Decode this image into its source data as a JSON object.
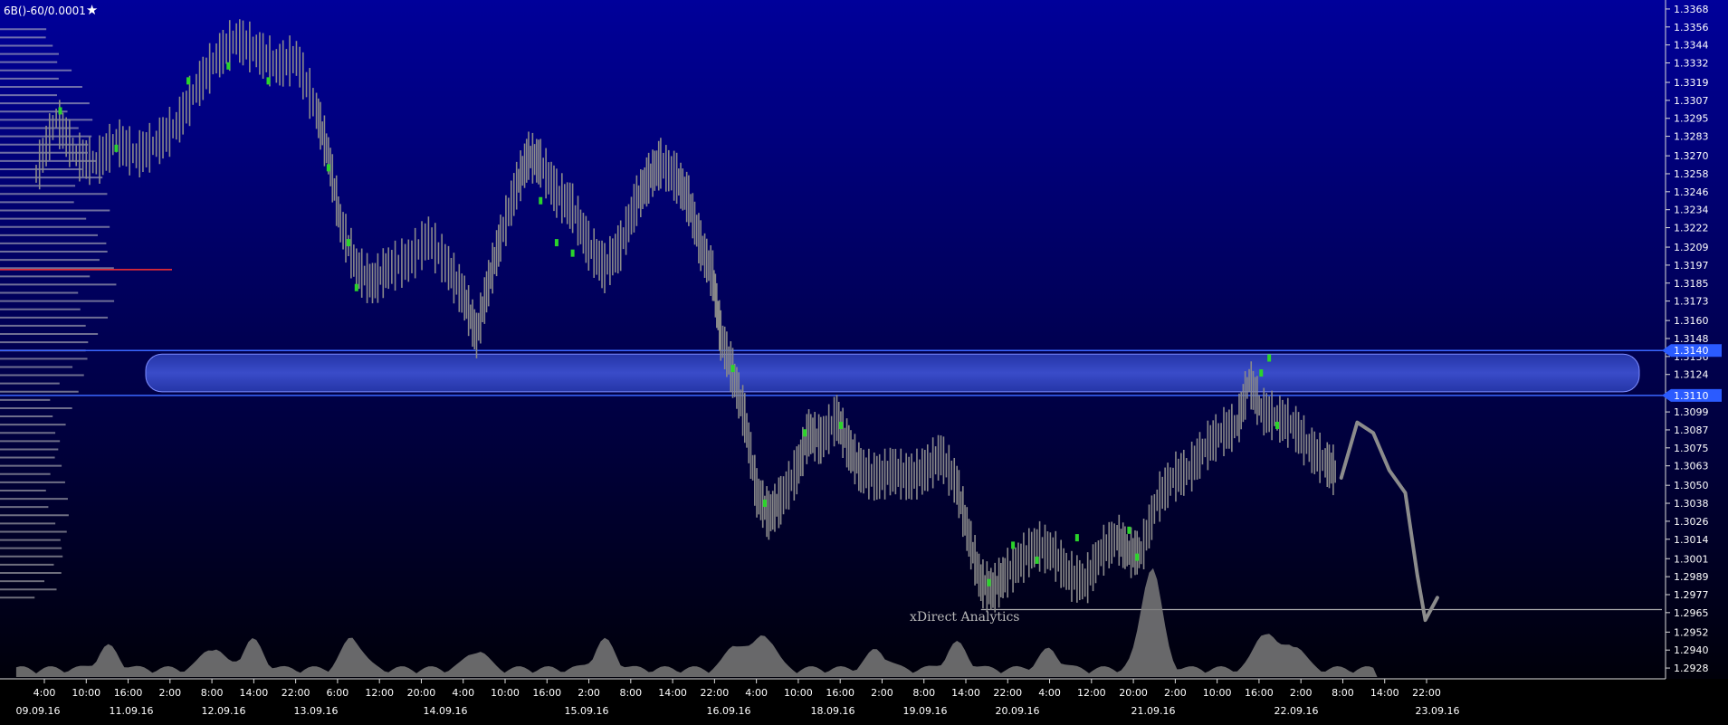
{
  "symbol": "6B()-60/0.0001",
  "watermark": "xDirect Analytics",
  "colors": {
    "background_top": "#00009a",
    "background_bottom": "#000000",
    "bar": "#8a8a8a",
    "highlight": "#2bd42b",
    "zone_fill": "#2c3fb8",
    "zone_line": "#3a66ff",
    "tag": "#2b5bff",
    "profile": "#c8c8c8",
    "poc": "#ff3030",
    "volume": "#7a7a7a",
    "arrow": "#8c8c8c"
  },
  "chart_data": {
    "type": "candlestick",
    "timeframe": "60",
    "ylim": [
      1.2922,
      1.3374
    ],
    "y_ticks": [
      "1.3368",
      "1.3356",
      "1.3344",
      "1.3332",
      "1.3319",
      "1.3307",
      "1.3295",
      "1.3283",
      "1.3270",
      "1.3258",
      "1.3246",
      "1.3234",
      "1.3222",
      "1.3209",
      "1.3197",
      "1.3185",
      "1.3173",
      "1.3160",
      "1.3148",
      "1.3136",
      "1.3124",
      "1.3099",
      "1.3087",
      "1.3075",
      "1.3063",
      "1.3050",
      "1.3038",
      "1.3026",
      "1.3014",
      "1.3001",
      "1.2989",
      "1.2977",
      "1.2965",
      "1.2952",
      "1.2940",
      "1.2928"
    ],
    "time_ticks": [
      "4:00",
      "10:00",
      "16:00",
      "2:00",
      "8:00",
      "14:00",
      "22:00",
      "6:00",
      "12:00",
      "20:00",
      "4:00",
      "10:00",
      "16:00",
      "2:00",
      "8:00",
      "14:00",
      "22:00",
      "4:00",
      "10:00",
      "16:00",
      "2:00",
      "8:00",
      "14:00",
      "22:00",
      "4:00",
      "12:00",
      "20:00",
      "2:00",
      "10:00",
      "16:00",
      "2:00",
      "8:00",
      "14:00",
      "22:00"
    ],
    "date_ticks": [
      "09.09.16",
      "11.09.16",
      "12.09.16",
      "13.09.16",
      "14.09.16",
      "15.09.16",
      "16.09.16",
      "18.09.16",
      "19.09.16",
      "20.09.16",
      "21.09.16",
      "22.09.16",
      "23.09.16"
    ],
    "zone": {
      "upper": 1.314,
      "lower": 1.311,
      "upper_label": "1.3140",
      "lower_label": "1.3110"
    },
    "support_level": 1.2967,
    "poc_level": 1.3194,
    "price_path": [
      [
        0,
        1.3258
      ],
      [
        0.5,
        1.3295
      ],
      [
        1,
        1.327
      ],
      [
        1.5,
        1.3265
      ],
      [
        2,
        1.328
      ],
      [
        2.5,
        1.327
      ],
      [
        3,
        1.3278
      ],
      [
        3.5,
        1.329
      ],
      [
        4,
        1.3315
      ],
      [
        4.5,
        1.3335
      ],
      [
        5,
        1.3348
      ],
      [
        5.5,
        1.334
      ],
      [
        6,
        1.333
      ],
      [
        6.5,
        1.3335
      ],
      [
        7,
        1.33
      ],
      [
        7.3,
        1.327
      ],
      [
        7.6,
        1.3225
      ],
      [
        8,
        1.3195
      ],
      [
        8.4,
        1.3185
      ],
      [
        8.8,
        1.3195
      ],
      [
        9.3,
        1.32
      ],
      [
        9.8,
        1.3215
      ],
      [
        10.3,
        1.3195
      ],
      [
        10.7,
        1.3175
      ],
      [
        11,
        1.315
      ],
      [
        11.3,
        1.3185
      ],
      [
        11.6,
        1.3215
      ],
      [
        12,
        1.325
      ],
      [
        12.3,
        1.327
      ],
      [
        12.6,
        1.3265
      ],
      [
        13,
        1.3245
      ],
      [
        13.4,
        1.3235
      ],
      [
        13.8,
        1.321
      ],
      [
        14.2,
        1.3195
      ],
      [
        14.6,
        1.321
      ],
      [
        15,
        1.324
      ],
      [
        15.3,
        1.3255
      ],
      [
        15.6,
        1.3265
      ],
      [
        16,
        1.3255
      ],
      [
        16.3,
        1.324
      ],
      [
        16.6,
        1.321
      ],
      [
        16.9,
        1.319
      ],
      [
        17.1,
        1.315
      ],
      [
        17.4,
        1.3125
      ],
      [
        17.7,
        1.3095
      ],
      [
        18,
        1.3045
      ],
      [
        18.3,
        1.303
      ],
      [
        18.6,
        1.304
      ],
      [
        19,
        1.306
      ],
      [
        19.3,
        1.3085
      ],
      [
        19.6,
        1.308
      ],
      [
        20,
        1.3095
      ],
      [
        20.3,
        1.3075
      ],
      [
        20.6,
        1.306
      ],
      [
        21,
        1.3055
      ],
      [
        21.4,
        1.306
      ],
      [
        21.8,
        1.3055
      ],
      [
        22.2,
        1.306
      ],
      [
        22.6,
        1.307
      ],
      [
        23,
        1.305
      ],
      [
        23.3,
        1.3015
      ],
      [
        23.6,
        1.2985
      ],
      [
        23.9,
        1.298
      ],
      [
        24.2,
        1.299
      ],
      [
        24.6,
        1.3
      ],
      [
        25,
        1.301
      ],
      [
        25.4,
        1.3005
      ],
      [
        25.8,
        1.299
      ],
      [
        26.2,
        1.2985
      ],
      [
        26.6,
        1.3005
      ],
      [
        27,
        1.3015
      ],
      [
        27.3,
        1.3005
      ],
      [
        27.6,
        1.3005
      ],
      [
        28,
        1.304
      ],
      [
        28.4,
        1.3055
      ],
      [
        28.8,
        1.306
      ],
      [
        29.2,
        1.3075
      ],
      [
        29.6,
        1.3085
      ],
      [
        30,
        1.309
      ],
      [
        30.3,
        1.312
      ],
      [
        30.6,
        1.31
      ],
      [
        31,
        1.3095
      ],
      [
        31.4,
        1.309
      ],
      [
        31.8,
        1.3075
      ],
      [
        32.2,
        1.3065
      ],
      [
        32.5,
        1.3058
      ]
    ],
    "highlighted_bars": [
      [
        0.6,
        1.33
      ],
      [
        2.0,
        1.3275
      ],
      [
        3.8,
        1.332
      ],
      [
        4.8,
        1.333
      ],
      [
        5.8,
        1.332
      ],
      [
        7.3,
        1.3262
      ],
      [
        7.8,
        1.3212
      ],
      [
        8.0,
        1.3182
      ],
      [
        12.6,
        1.324
      ],
      [
        13.0,
        1.3212
      ],
      [
        13.4,
        1.3205
      ],
      [
        17.4,
        1.3128
      ],
      [
        18.2,
        1.3038
      ],
      [
        19.2,
        1.3085
      ],
      [
        20.1,
        1.309
      ],
      [
        23.8,
        1.2985
      ],
      [
        24.4,
        1.301
      ],
      [
        25.0,
        1.3
      ],
      [
        26.0,
        1.3015
      ],
      [
        27.3,
        1.302
      ],
      [
        27.5,
        1.3002
      ],
      [
        30.6,
        1.3125
      ],
      [
        30.8,
        1.3135
      ],
      [
        31.0,
        1.309
      ]
    ],
    "projection_arrow": [
      [
        32.6,
        1.3055
      ],
      [
        33.0,
        1.3092
      ],
      [
        33.4,
        1.3085
      ],
      [
        33.8,
        1.306
      ],
      [
        34.2,
        1.3045
      ],
      [
        34.5,
        1.299
      ],
      [
        34.7,
        1.296
      ],
      [
        35.0,
        1.2975
      ]
    ],
    "volume_peaks": [
      [
        1.8,
        0.35
      ],
      [
        4.4,
        0.35
      ],
      [
        5.4,
        0.45
      ],
      [
        7.9,
        0.5
      ],
      [
        11.0,
        0.3
      ],
      [
        14.2,
        0.45
      ],
      [
        17.5,
        0.4
      ],
      [
        18.2,
        0.55
      ],
      [
        21.0,
        0.3
      ],
      [
        23.0,
        0.4
      ],
      [
        25.3,
        0.3
      ],
      [
        27.8,
        0.65
      ],
      [
        27.9,
        1.0
      ],
      [
        30.7,
        0.6
      ],
      [
        31.4,
        0.4
      ]
    ]
  }
}
